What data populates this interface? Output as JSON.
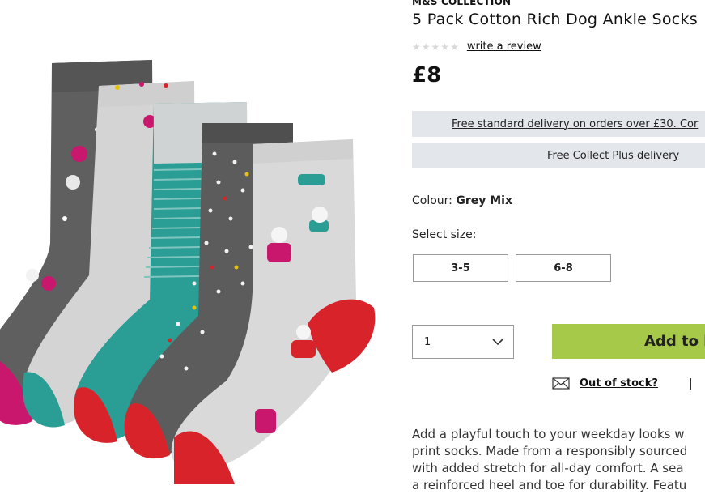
{
  "product": {
    "brand": "M&S COLLECTION",
    "title": "5 Pack Cotton Rich Dog Ankle Socks",
    "rating_stars": 5,
    "review_link": "write a review",
    "price": "£8",
    "image_alt": "5 pack of grey, teal and red dog print ankle socks"
  },
  "delivery": {
    "standard": "Free standard delivery on orders over £30. Cor",
    "collect": "Free Collect Plus delivery"
  },
  "colour": {
    "label": "Colour:",
    "value": "Grey Mix"
  },
  "size": {
    "label": "Select size:",
    "options": [
      "3-5",
      "6-8"
    ]
  },
  "purchase": {
    "quantity": "1",
    "add_label": "Add to b",
    "stock_link": "Out of stock?",
    "divider": "|"
  },
  "description": {
    "lines": [
      "Add a playful touch to your weekday looks w",
      "print socks. Made from a responsibly sourced",
      "with added stretch for all-day comfort. A sea",
      "a reinforced heel and toe for durability. Featu"
    ]
  },
  "colors": {
    "delivery_bg": "#e3e6ea",
    "add_button": "#a7c94a",
    "sock_dark": "#5f5f5f",
    "sock_light": "#d9d9d9",
    "sock_teal": "#2a9d94",
    "sock_red": "#d8232a",
    "sock_magenta": "#c9176e"
  }
}
